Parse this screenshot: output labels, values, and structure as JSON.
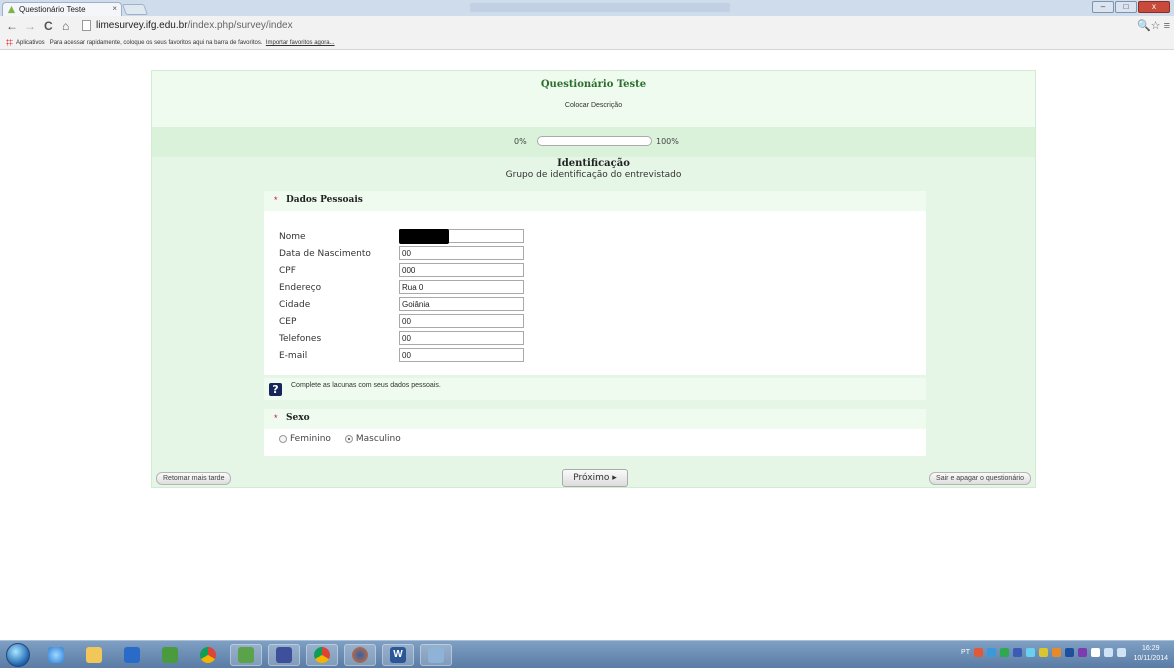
{
  "browser": {
    "tab_title": "Questionário Teste",
    "tab_close": "×",
    "url_host": "limesurvey.ifg.edu.br",
    "url_path": "/index.php/survey/index",
    "bookmarks_apps": "Aplicativos",
    "bookmarks_hint": "Para acessar rapidamente, coloque os seus favoritos aqui na barra de favoritos.",
    "bookmarks_import": "Importar favoritos agora...",
    "back_icon": "←",
    "forward_icon": "→",
    "reload_icon": "C",
    "home_icon": "⌂",
    "toolbar_right": "🔍☆ ≡"
  },
  "survey": {
    "title": "Questionário Teste",
    "description": "Colocar Descrição",
    "progress": {
      "start_label": "0%",
      "end_label": "100%",
      "value": 0
    },
    "group": {
      "title": "Identificação",
      "description": "Grupo de identificação do entrevistado"
    },
    "question1": {
      "mandatory_mark": "*",
      "title": "Dados Pessoais",
      "fields": [
        {
          "label": "Nome",
          "value": ""
        },
        {
          "label": "Data de Nascimento",
          "value": "00"
        },
        {
          "label": "CPF",
          "value": "000"
        },
        {
          "label": "Endereço",
          "value": "Rua 0"
        },
        {
          "label": "Cidade",
          "value": "Goiânia"
        },
        {
          "label": "CEP",
          "value": "00"
        },
        {
          "label": "Telefones",
          "value": "00"
        },
        {
          "label": "E-mail",
          "value": "00"
        }
      ],
      "help_icon": "?",
      "help_text": "Complete as lacunas com seus dados pessoais."
    },
    "question2": {
      "mandatory_mark": "*",
      "title": "Sexo",
      "options": [
        {
          "label": "Feminino",
          "selected": false
        },
        {
          "label": "Masculino",
          "selected": true
        }
      ]
    },
    "footer": {
      "resume_later": "Retomar mais tarde",
      "next": "Próximo ▸",
      "clear_exit": "Sair e apagar o questionário"
    }
  },
  "taskbar": {
    "clock_time": "16:29",
    "clock_date": "10/11/2014",
    "tray_lang": "PT"
  }
}
